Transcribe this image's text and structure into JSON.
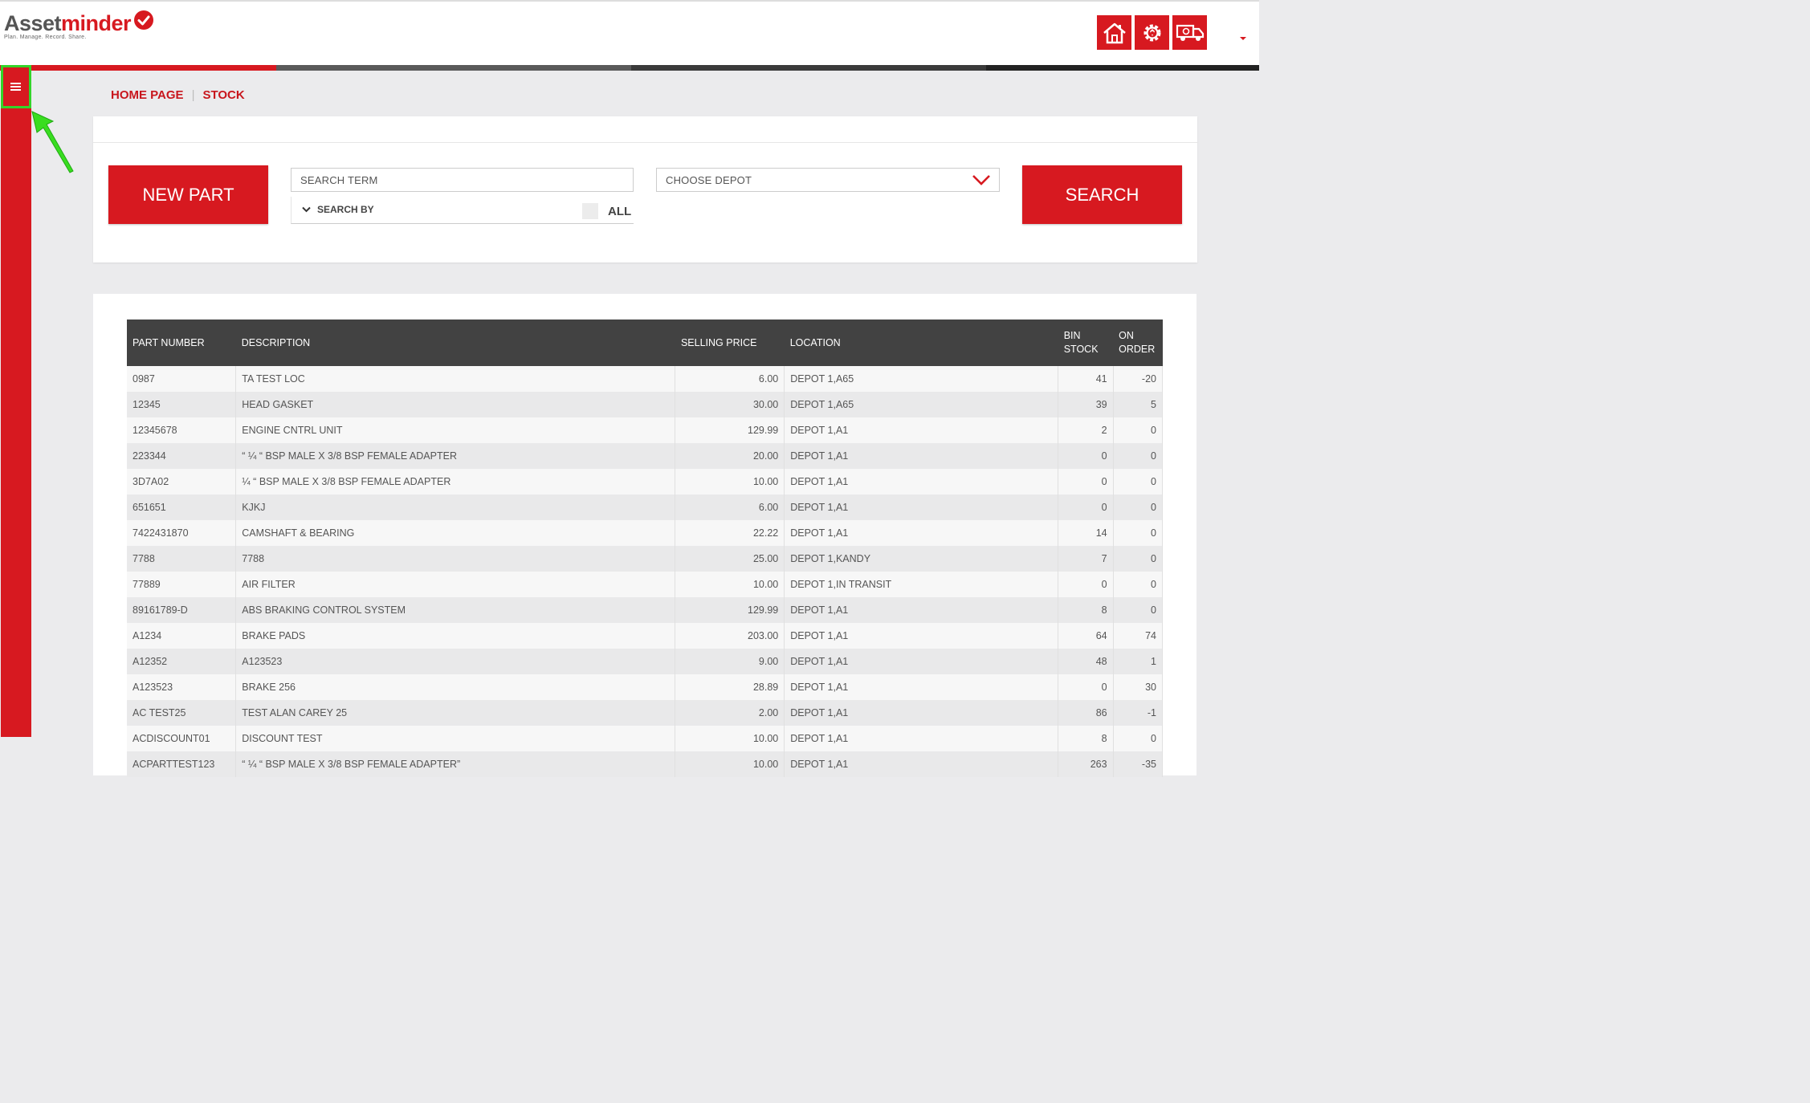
{
  "brand": {
    "name_part1": "Asset",
    "name_part2": "minder",
    "tagline": "Plan. Manage. Record. Share."
  },
  "header": {
    "icons": [
      {
        "name": "home-icon"
      },
      {
        "name": "settings-gear-icon"
      },
      {
        "name": "truck-icon"
      }
    ]
  },
  "breadcrumb": {
    "home": "HOME PAGE",
    "current": "STOCK"
  },
  "search": {
    "new_part_label": "NEW PART",
    "term_placeholder": "SEARCH TERM",
    "search_by_label": "SEARCH BY",
    "all_label": "ALL",
    "depot_placeholder": "CHOOSE DEPOT",
    "search_label": "SEARCH"
  },
  "table": {
    "columns": [
      "PART NUMBER",
      "DESCRIPTION",
      "SELLING PRICE",
      "LOCATION",
      "BIN STOCK",
      "ON ORDER"
    ],
    "rows": [
      [
        "0987",
        "TA TEST LOC",
        "6.00",
        "DEPOT 1,A65",
        "41",
        "-20"
      ],
      [
        "12345",
        "HEAD GASKET",
        "30.00",
        "DEPOT 1,A65",
        "39",
        "5"
      ],
      [
        "12345678",
        "ENGINE CNTRL UNIT",
        "129.99",
        "DEPOT 1,A1",
        "2",
        "0"
      ],
      [
        "223344",
        "“ ¼ “ BSP MALE X 3/8 BSP FEMALE ADAPTER",
        "20.00",
        "DEPOT 1,A1",
        "0",
        "0"
      ],
      [
        "3D7A02",
        "¼ “ BSP MALE X 3/8 BSP FEMALE ADAPTER",
        "10.00",
        "DEPOT 1,A1",
        "0",
        "0"
      ],
      [
        "651651",
        "KJKJ",
        "6.00",
        "DEPOT 1,A1",
        "0",
        "0"
      ],
      [
        "7422431870",
        "CAMSHAFT & BEARING",
        "22.22",
        "DEPOT 1,A1",
        "14",
        "0"
      ],
      [
        "7788",
        "7788",
        "25.00",
        "DEPOT 1,KANDY",
        "7",
        "0"
      ],
      [
        "77889",
        "AIR FILTER",
        "10.00",
        "DEPOT 1,IN TRANSIT",
        "0",
        "0"
      ],
      [
        "89161789-D",
        "ABS BRAKING CONTROL SYSTEM",
        "129.99",
        "DEPOT 1,A1",
        "8",
        "0"
      ],
      [
        "A1234",
        "BRAKE PADS",
        "203.00",
        "DEPOT 1,A1",
        "64",
        "74"
      ],
      [
        "A12352",
        "A123523",
        "9.00",
        "DEPOT 1,A1",
        "48",
        "1"
      ],
      [
        "A123523",
        "BRAKE 256",
        "28.89",
        "DEPOT 1,A1",
        "0",
        "30"
      ],
      [
        "AC TEST25",
        "TEST ALAN CAREY 25",
        "2.00",
        "DEPOT 1,A1",
        "86",
        "-1"
      ],
      [
        "ACDISCOUNT01",
        "DISCOUNT TEST",
        "10.00",
        "DEPOT 1,A1",
        "8",
        "0"
      ],
      [
        "ACPARTTEST123",
        "“ ¼ “ BSP MALE X 3/8 BSP FEMALE ADAPTER”",
        "10.00",
        "DEPOT 1,A1",
        "263",
        "-35"
      ]
    ]
  },
  "colors": {
    "brand_red": "#d71920",
    "header_dark": "#424242",
    "highlight_green": "#33d52a"
  }
}
